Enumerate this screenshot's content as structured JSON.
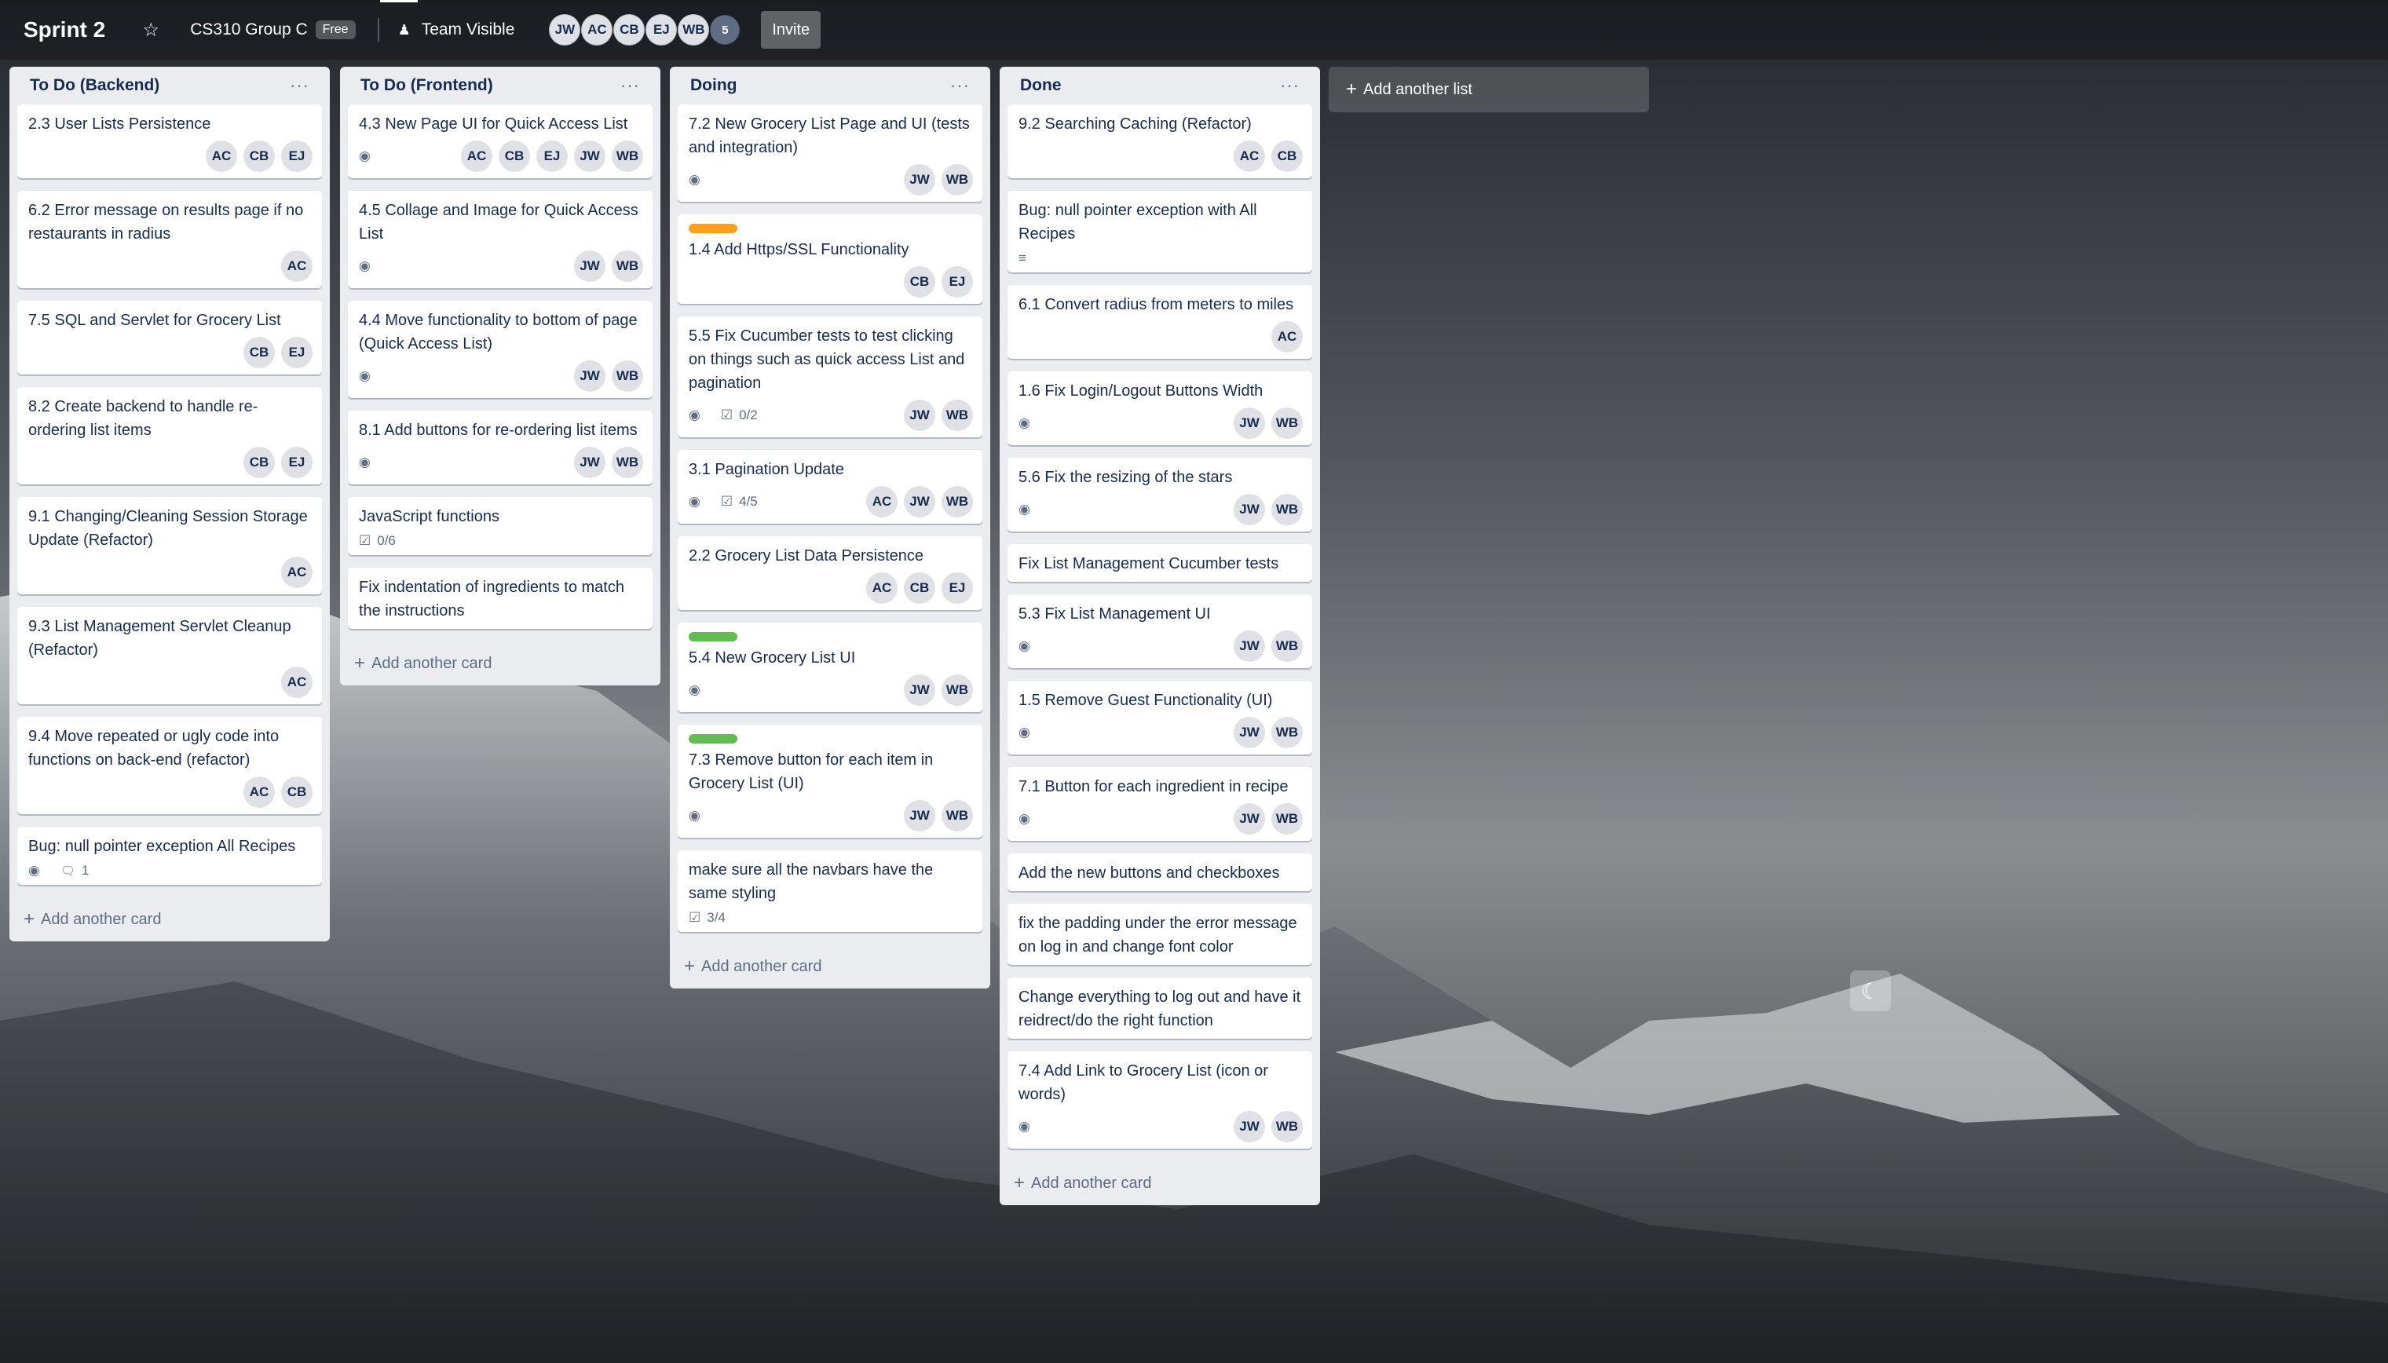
{
  "header": {
    "board_title": "Sprint 2",
    "star_icon": "star-icon",
    "workspace_name": "CS310 Group C",
    "plan_badge": "Free",
    "visibility_label": "Team Visible",
    "visibility_icon": "team-icon",
    "members": [
      "JW",
      "AC",
      "CB",
      "EJ",
      "WB"
    ],
    "members_more": "5",
    "invite_label": "Invite"
  },
  "colors": {
    "label_orange": "#ff9f1a",
    "label_green": "#61bd4f"
  },
  "lists": [
    {
      "title": "To Do (Backend)",
      "menu": "···",
      "add_card": "Add another card",
      "cards": [
        {
          "title": "2.3 User Lists Persistence",
          "members": [
            "AC",
            "CB",
            "EJ"
          ]
        },
        {
          "title": "6.2 Error message on results page if no restaurants in radius",
          "members": [
            "AC"
          ]
        },
        {
          "title": "7.5 SQL and Servlet for Grocery List",
          "members": [
            "CB",
            "EJ"
          ]
        },
        {
          "title": "8.2 Create backend to handle re-ordering list items",
          "members": [
            "CB",
            "EJ"
          ]
        },
        {
          "title": "9.1 Changing/Cleaning Session Storage Update (Refactor)",
          "members": [
            "AC"
          ]
        },
        {
          "title": "9.3 List Management Servlet Cleanup (Refactor)",
          "members": [
            "AC"
          ]
        },
        {
          "title": "9.4 Move repeated or ugly code into functions on back-end (refactor)",
          "members": [
            "AC",
            "CB"
          ]
        },
        {
          "title": "Bug: null pointer exception All Recipes",
          "watch": true,
          "comments": "1"
        }
      ]
    },
    {
      "title": "To Do (Frontend)",
      "menu": "···",
      "add_card": "Add another card",
      "cards": [
        {
          "title": "4.3 New Page UI for Quick Access List",
          "watch": true,
          "members": [
            "AC",
            "CB",
            "EJ",
            "JW",
            "WB"
          ]
        },
        {
          "title": "4.5 Collage and Image for Quick Access List",
          "watch": true,
          "members": [
            "JW",
            "WB"
          ]
        },
        {
          "title": "4.4 Move functionality to bottom of page (Quick Access List)",
          "watch": true,
          "members": [
            "JW",
            "WB"
          ]
        },
        {
          "title": "8.1 Add buttons for re-ordering list items",
          "watch": true,
          "members": [
            "JW",
            "WB"
          ]
        },
        {
          "title": "JavaScript functions",
          "checklist": "0/6"
        },
        {
          "title": "Fix indentation of ingredients to match the instructions"
        }
      ]
    },
    {
      "title": "Doing",
      "menu": "···",
      "add_card": "Add another card",
      "cards": [
        {
          "title": "7.2 New Grocery List Page and UI (tests and integration)",
          "watch": true,
          "members": [
            "JW",
            "WB"
          ]
        },
        {
          "title": "1.4 Add Https/SSL Functionality",
          "label": "orange",
          "members": [
            "CB",
            "EJ"
          ]
        },
        {
          "title": "5.5 Fix Cucumber tests to test clicking on things such as quick access List and pagination",
          "watch": true,
          "checklist": "0/2",
          "members": [
            "JW",
            "WB"
          ]
        },
        {
          "title": "3.1 Pagination Update",
          "watch": true,
          "checklist": "4/5",
          "members": [
            "AC",
            "JW",
            "WB"
          ]
        },
        {
          "title": "2.2 Grocery List Data Persistence",
          "members": [
            "AC",
            "CB",
            "EJ"
          ]
        },
        {
          "title": "5.4 New Grocery List UI",
          "label": "green",
          "watch": true,
          "members": [
            "JW",
            "WB"
          ]
        },
        {
          "title": "7.3 Remove button for each item in Grocery List (UI)",
          "label": "green",
          "watch": true,
          "members": [
            "JW",
            "WB"
          ]
        },
        {
          "title": "make sure all the navbars have the same styling",
          "checklist": "3/4"
        }
      ]
    },
    {
      "title": "Done",
      "menu": "···",
      "add_card": "Add another card",
      "cards": [
        {
          "title": "9.2 Searching Caching (Refactor)",
          "members": [
            "AC",
            "CB"
          ]
        },
        {
          "title": "Bug: null pointer exception with All Recipes",
          "description": true
        },
        {
          "title": "6.1 Convert radius from meters to miles",
          "members": [
            "AC"
          ]
        },
        {
          "title": "1.6 Fix Login/Logout Buttons Width",
          "watch": true,
          "members": [
            "JW",
            "WB"
          ]
        },
        {
          "title": "5.6 Fix the resizing of the stars",
          "watch": true,
          "members": [
            "JW",
            "WB"
          ]
        },
        {
          "title": "Fix List Management Cucumber tests"
        },
        {
          "title": "5.3 Fix List Management UI",
          "watch": true,
          "members": [
            "JW",
            "WB"
          ]
        },
        {
          "title": "1.5 Remove Guest Functionality (UI)",
          "watch": true,
          "members": [
            "JW",
            "WB"
          ]
        },
        {
          "title": "7.1 Button for each ingredient in recipe",
          "watch": true,
          "members": [
            "JW",
            "WB"
          ]
        },
        {
          "title": "Add the new buttons and checkboxes"
        },
        {
          "title": "fix the padding under the error message on log in and change font color"
        },
        {
          "title": "Change everything to log out and have it reidrect/do the right function"
        },
        {
          "title": "7.4 Add Link to Grocery List (icon or words)",
          "watch": true,
          "members": [
            "JW",
            "WB"
          ]
        }
      ]
    }
  ],
  "add_list_label": "Add another list"
}
